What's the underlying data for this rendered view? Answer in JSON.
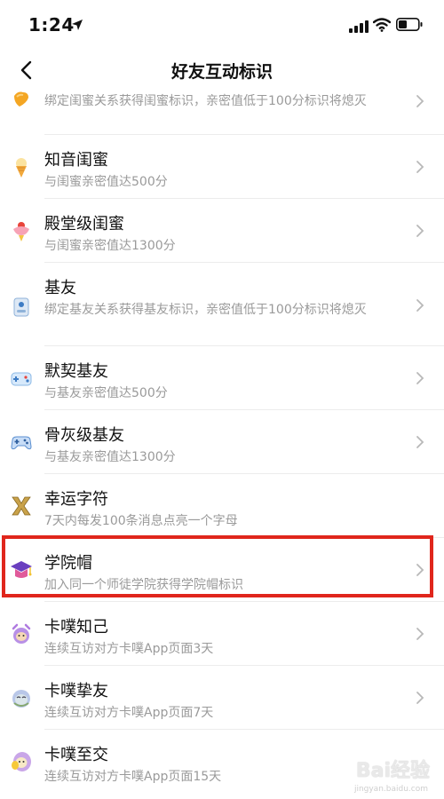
{
  "status_bar": {
    "time": "1:24"
  },
  "nav": {
    "title": "好友互动标识"
  },
  "items": [
    {
      "title": "",
      "desc": "绑定闺蜜关系获得闺蜜标识，亲密值低于100分标识将熄灭",
      "icon": "orange-heart-icon"
    },
    {
      "title": "知音闺蜜",
      "desc": "与闺蜜亲密值达500分",
      "icon": "ice-cream-cone-icon"
    },
    {
      "title": "殿堂级闺蜜",
      "desc": "与闺蜜亲密值达1300分",
      "icon": "sundae-icon"
    },
    {
      "title": "基友",
      "desc": "绑定基友关系获得基友标识，亲密值低于100分标识将熄灭",
      "icon": "joystick-icon"
    },
    {
      "title": "默契基友",
      "desc": "与基友亲密值达500分",
      "icon": "handheld-console-icon"
    },
    {
      "title": "骨灰级基友",
      "desc": "与基友亲密值达1300分",
      "icon": "gamepad-icon"
    },
    {
      "title": "幸运字符",
      "desc": "7天内每发100条消息点亮一个字母",
      "icon": "letter-x-icon"
    },
    {
      "title": "学院帽",
      "desc": "加入同一个师徒学院获得学院帽标识",
      "icon": "graduation-cap-icon"
    },
    {
      "title": "卡噗知己",
      "desc": "连续互访对方卡噗App页面3天",
      "icon": "purple-character-icon"
    },
    {
      "title": "卡噗挚友",
      "desc": "连续互访对方卡噗App页面7天",
      "icon": "blue-character-icon"
    },
    {
      "title": "卡噗至交",
      "desc": "连续互访对方卡噗App页面15天",
      "icon": "yellow-character-icon"
    }
  ],
  "watermark": {
    "text": "Bai经验",
    "sub": "jingyan.baidu.com"
  },
  "colors": {
    "highlight": "#e0261c",
    "desc_text": "#9a9a9a",
    "chevron": "#b8b8b8"
  }
}
